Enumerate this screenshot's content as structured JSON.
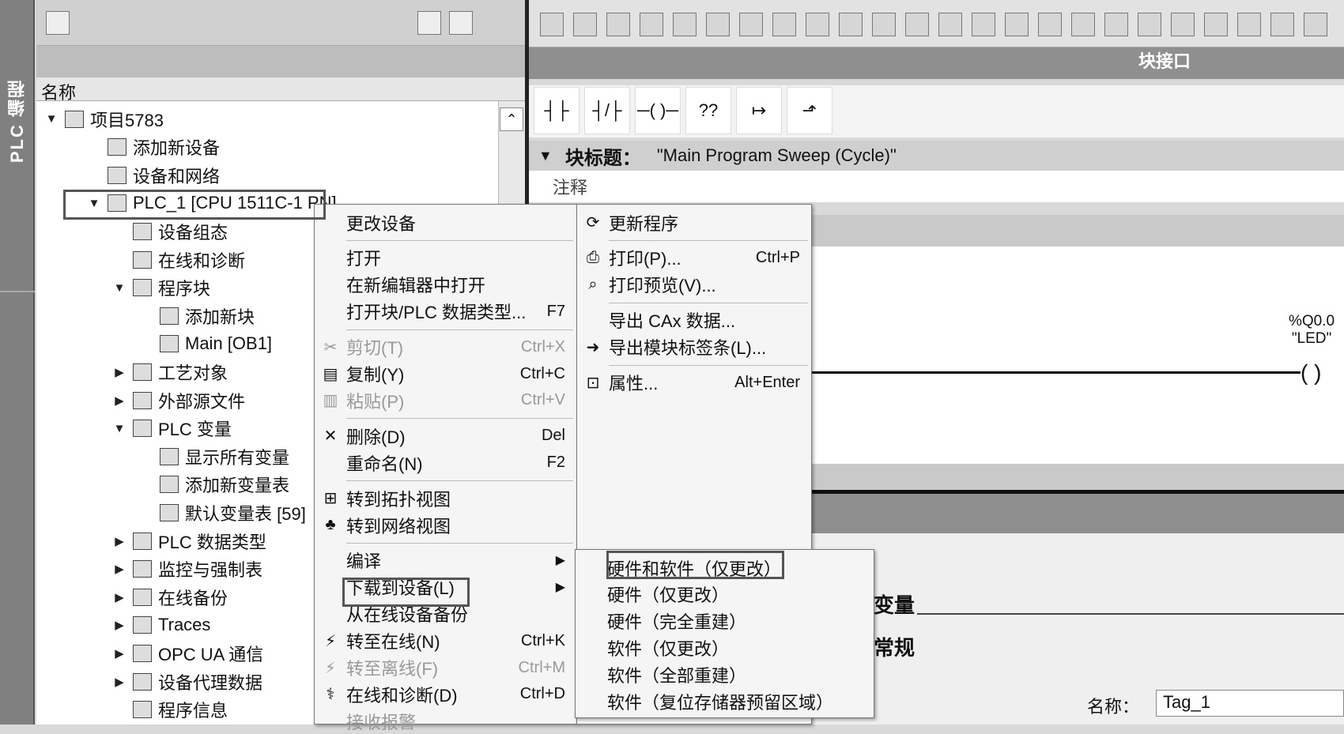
{
  "side_tab": {
    "label": "PLC 编程"
  },
  "project_tree": {
    "header": "名称",
    "items": [
      {
        "label": "项目5783",
        "indent": 0,
        "expand": "▼",
        "icon": "project-icon"
      },
      {
        "label": "添加新设备",
        "indent": 1,
        "expand": "",
        "icon": "add-device-icon"
      },
      {
        "label": "设备和网络",
        "indent": 1,
        "expand": "",
        "icon": "network-icon"
      },
      {
        "label": "PLC_1 [CPU 1511C-1 PN]",
        "indent": 1,
        "expand": "▼",
        "icon": "plc-icon"
      },
      {
        "label": "设备组态",
        "indent": 2,
        "expand": "",
        "icon": "device-config-icon"
      },
      {
        "label": "在线和诊断",
        "indent": 2,
        "expand": "",
        "icon": "diagnostics-icon"
      },
      {
        "label": "程序块",
        "indent": 2,
        "expand": "▼",
        "icon": "folder-icon"
      },
      {
        "label": "添加新块",
        "indent": 3,
        "expand": "",
        "icon": "add-block-icon"
      },
      {
        "label": "Main [OB1]",
        "indent": 3,
        "expand": "",
        "icon": "ob-icon"
      },
      {
        "label": "工艺对象",
        "indent": 2,
        "expand": "▶",
        "icon": "folder-icon"
      },
      {
        "label": "外部源文件",
        "indent": 2,
        "expand": "▶",
        "icon": "folder-icon"
      },
      {
        "label": "PLC 变量",
        "indent": 2,
        "expand": "▼",
        "icon": "folder-icon"
      },
      {
        "label": "显示所有变量",
        "indent": 3,
        "expand": "",
        "icon": "tags-icon"
      },
      {
        "label": "添加新变量表",
        "indent": 3,
        "expand": "",
        "icon": "add-table-icon"
      },
      {
        "label": "默认变量表 [59]",
        "indent": 3,
        "expand": "",
        "icon": "tag-table-icon"
      },
      {
        "label": "PLC 数据类型",
        "indent": 2,
        "expand": "▶",
        "icon": "folder-icon"
      },
      {
        "label": "监控与强制表",
        "indent": 2,
        "expand": "▶",
        "icon": "folder-icon"
      },
      {
        "label": "在线备份",
        "indent": 2,
        "expand": "▶",
        "icon": "folder-icon"
      },
      {
        "label": "Traces",
        "indent": 2,
        "expand": "▶",
        "icon": "folder-icon"
      },
      {
        "label": "OPC UA 通信",
        "indent": 2,
        "expand": "▶",
        "icon": "folder-icon"
      },
      {
        "label": "设备代理数据",
        "indent": 2,
        "expand": "▶",
        "icon": "folder-icon"
      },
      {
        "label": "程序信息",
        "indent": 2,
        "expand": "",
        "icon": "info-icon"
      }
    ]
  },
  "editor": {
    "interface_label": "块接口",
    "block_title_label": "块标题：",
    "block_title_value": "\"Main Program Sweep (Cycle)\"",
    "comment_label": "注释",
    "coil_address": "%Q0.0",
    "coil_name": "\"LED\"",
    "lad_buttons": [
      "┤├",
      "┤/├",
      "─( )─",
      "??",
      "↦",
      "⬏"
    ]
  },
  "properties": {
    "section_variable": "变量",
    "section_general": "常规",
    "name_label": "名称：",
    "name_value": "Tag_1"
  },
  "context_menu_1": {
    "items": [
      {
        "label": "更改设备",
        "key": "",
        "icon": "",
        "disabled": false,
        "arrow": ""
      },
      {
        "sep": true
      },
      {
        "label": "打开",
        "key": "",
        "icon": "",
        "disabled": false,
        "arrow": ""
      },
      {
        "label": "在新编辑器中打开",
        "key": "",
        "icon": "",
        "disabled": false,
        "arrow": ""
      },
      {
        "label": "打开块/PLC 数据类型...",
        "key": "F7",
        "icon": "",
        "disabled": false,
        "arrow": ""
      },
      {
        "sep": true
      },
      {
        "label": "剪切(T)",
        "key": "Ctrl+X",
        "icon": "✂",
        "disabled": true,
        "arrow": ""
      },
      {
        "label": "复制(Y)",
        "key": "Ctrl+C",
        "icon": "▤",
        "disabled": false,
        "arrow": ""
      },
      {
        "label": "粘贴(P)",
        "key": "Ctrl+V",
        "icon": "▥",
        "disabled": true,
        "arrow": ""
      },
      {
        "sep": true
      },
      {
        "label": "删除(D)",
        "key": "Del",
        "icon": "✕",
        "disabled": false,
        "arrow": ""
      },
      {
        "label": "重命名(N)",
        "key": "F2",
        "icon": "",
        "disabled": false,
        "arrow": ""
      },
      {
        "sep": true
      },
      {
        "label": "转到拓扑视图",
        "key": "",
        "icon": "⊞",
        "disabled": false,
        "arrow": ""
      },
      {
        "label": "转到网络视图",
        "key": "",
        "icon": "♣",
        "disabled": false,
        "arrow": ""
      },
      {
        "sep": true
      },
      {
        "label": "编译",
        "key": "",
        "icon": "",
        "disabled": false,
        "arrow": "▶"
      },
      {
        "label": "下载到设备(L)",
        "key": "",
        "icon": "",
        "disabled": false,
        "arrow": "▶"
      },
      {
        "label": "从在线设备备份",
        "key": "",
        "icon": "",
        "disabled": false,
        "arrow": ""
      },
      {
        "label": "转至在线(N)",
        "key": "Ctrl+K",
        "icon": "⚡",
        "disabled": false,
        "arrow": ""
      },
      {
        "label": "转至离线(F)",
        "key": "Ctrl+M",
        "icon": "⚡",
        "disabled": true,
        "arrow": ""
      },
      {
        "label": "在线和诊断(D)",
        "key": "Ctrl+D",
        "icon": "⚕",
        "disabled": false,
        "arrow": ""
      },
      {
        "label": "接收报警",
        "key": "",
        "icon": "",
        "disabled": true,
        "arrow": ""
      }
    ]
  },
  "context_menu_2": {
    "items": [
      {
        "label": "更新程序",
        "key": "",
        "icon": "⟳",
        "disabled": false
      },
      {
        "sep": true
      },
      {
        "label": "打印(P)...",
        "key": "Ctrl+P",
        "icon": "⎙",
        "disabled": false
      },
      {
        "label": "打印预览(V)...",
        "key": "",
        "icon": "⌕",
        "disabled": false
      },
      {
        "sep": true
      },
      {
        "label": "导出 CAx 数据...",
        "key": "",
        "icon": "",
        "disabled": false
      },
      {
        "label": "导出模块标签条(L)...",
        "key": "",
        "icon": "➜",
        "disabled": false
      },
      {
        "sep": true
      },
      {
        "label": "属性...",
        "key": "Alt+Enter",
        "icon": "⊡",
        "disabled": false
      }
    ]
  },
  "submenu_download": {
    "items": [
      {
        "label": "硬件和软件（仅更改）"
      },
      {
        "label": "硬件（仅更改）"
      },
      {
        "label": "硬件（完全重建）"
      },
      {
        "label": "软件（仅更改）"
      },
      {
        "label": "软件（全部重建）"
      },
      {
        "label": "软件（复位存储器预留区域）"
      }
    ]
  }
}
